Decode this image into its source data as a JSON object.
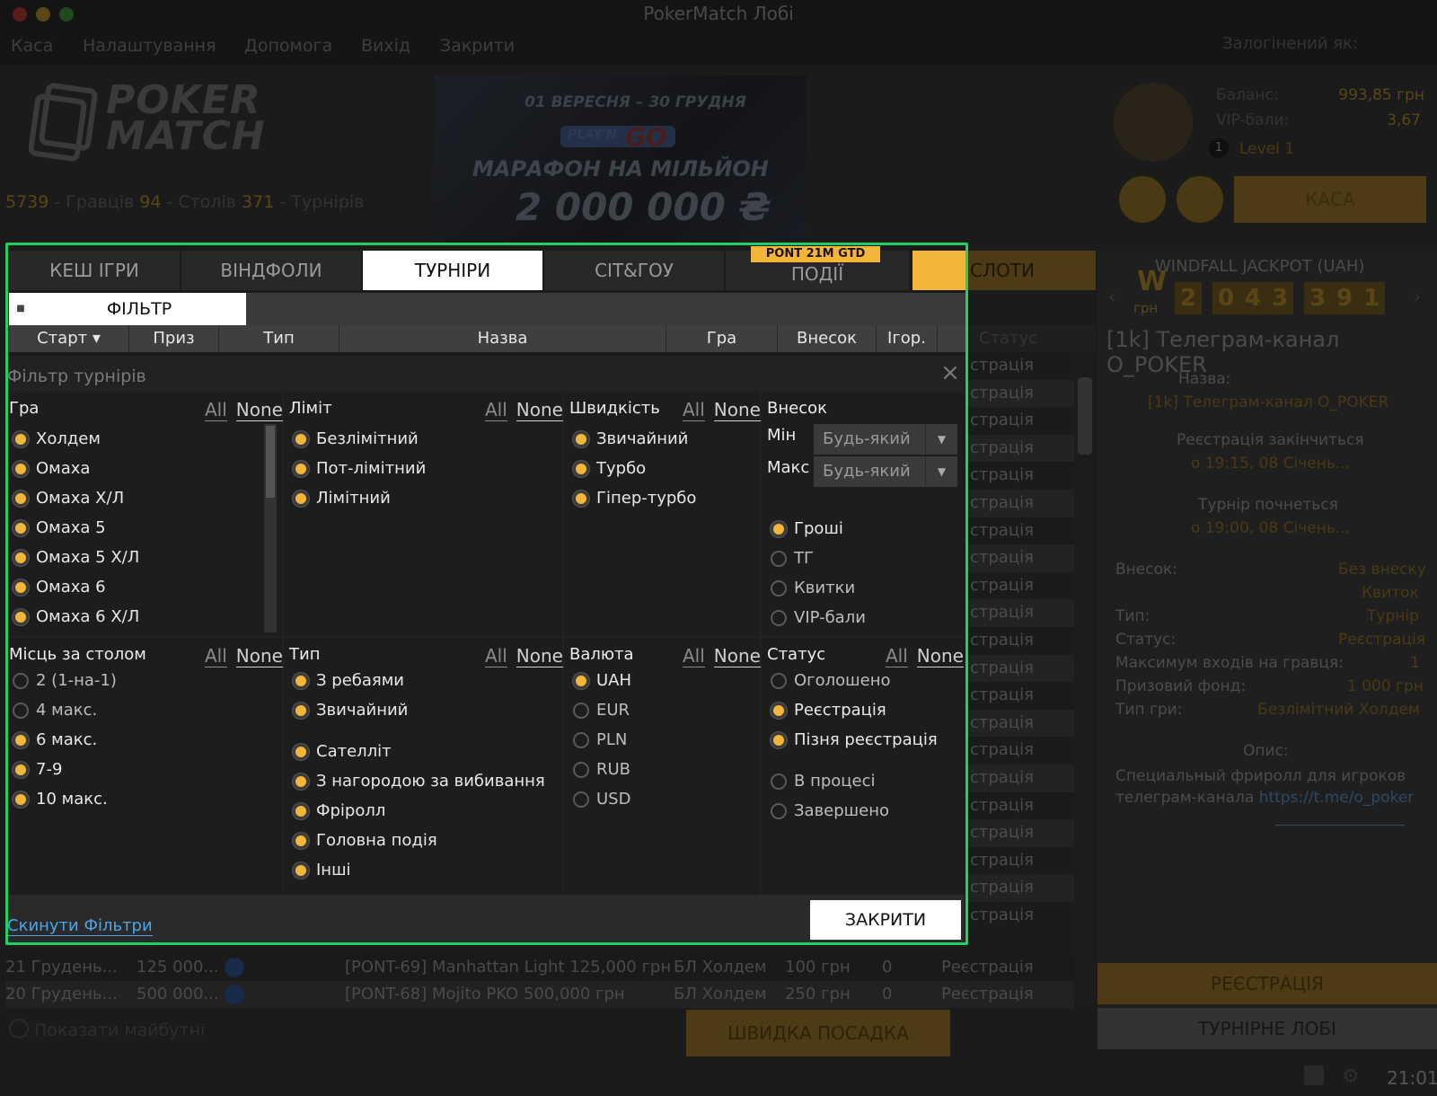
{
  "window": {
    "title": "PokerMatch Лобі"
  },
  "menu": [
    "Каса",
    "Налаштування",
    "Допомога",
    "Вихід",
    "Закрити"
  ],
  "logged_in_label": "Залогінений як:",
  "logo": {
    "line1": "POKER",
    "line2": "MATCH"
  },
  "stats": {
    "players": "5739",
    "players_label": "- Гравців",
    "tables": "94",
    "tables_label": "- Столів",
    "tournaments": "371",
    "tournaments_label": "- Турнірів"
  },
  "banner": {
    "dates": "01 ВЕРЕСНЯ – 30 ГРУДНЯ",
    "brand_a": "PLAY'N",
    "brand_b": "GO",
    "title": "МАРАФОН НА МІЛЬЙОН",
    "amount": "2 000 000 ₴"
  },
  "account": {
    "balance_label": "Баланс:",
    "balance": "993,85 грн",
    "vip_label": "VIP-бали:",
    "vip": "3,67",
    "level_num": "1",
    "level": "Level 1",
    "cashier": "КАСА"
  },
  "tabs": [
    "КЕШ ІГРИ",
    "ВІНДФОЛИ",
    "ТУРНІРИ",
    "СІТ&ГОУ",
    "ПОДІЇ"
  ],
  "promo_badge": "PONT 21M GTD",
  "slots_tab": "СЛОТИ",
  "filter_button": "ФІЛЬТР",
  "columns": [
    "Старт ▾",
    "Приз",
    "Тип",
    "Назва",
    "Гра",
    "Внесок",
    "Ігор."
  ],
  "status_header": "Статус",
  "status_fragment": "страція",
  "list_rows": [
    {
      "start": "21 Грудень...",
      "prize": "125 000...",
      "name": "[PONT-69] Manhattan Light 125,000 грн",
      "game": "БЛ Холдем",
      "buyin": "100 грн",
      "players": "0",
      "status": "Реєстрація"
    },
    {
      "start": "20 Грудень...",
      "prize": "500 000...",
      "name": "[PONT-68] Mojito PKO 500,000 грн",
      "game": "БЛ Холдем",
      "buyin": "250 грн",
      "players": "0",
      "status": "Реєстрація"
    }
  ],
  "show_future": "Показати майбутні",
  "fast_seat": "ШВИДКА ПОСАДКА",
  "jackpot": {
    "title": "WINDFALL JACKPOT (UAH)",
    "currency_w": "W",
    "currency": "грн",
    "digits": [
      "2",
      "0",
      "4",
      "3",
      "3",
      "9",
      "1"
    ]
  },
  "details": {
    "title": "[1k] Телеграм-канал O_POKER",
    "name_label": "Назва:",
    "name": "[1k] Телеграм-канал O_POKER",
    "reg_ends_label": "Реєстрація закінчиться",
    "reg_ends": "о 19:15, 08 Січень...",
    "starts_label": "Турнір почнеться",
    "starts": "о 19:00, 08 Січень...",
    "buyin_label": "Внесок:",
    "buyin": "Без внеску",
    "buyin2": "Квиток",
    "type_label": "Тип:",
    "type": "Турнір",
    "status_label": "Статус:",
    "status": "Реєстрація",
    "max_entries_label": "Максимум входів на гравця:",
    "max_entries": "1",
    "prize_label": "Призовий фонд:",
    "prize": "1 000 грн",
    "game_label": "Тип гри:",
    "game": "Безлімітний Холдем",
    "desc_label": "Опис:",
    "desc": "Специальный фриролл для игроков телеграм-канала",
    "desc_link": "https://t.me/o_poker",
    "register": "РЕЄСТРАЦІЯ",
    "lobby": "ТУРНІРНЕ ЛОБІ"
  },
  "clock": "21:01",
  "filter": {
    "title": "Фільтр турнірів",
    "all": "All",
    "none": "None",
    "game": {
      "title": "Гра",
      "options": [
        {
          "label": "Холдем",
          "on": true
        },
        {
          "label": "Омаха",
          "on": true
        },
        {
          "label": "Омаха Х/Л",
          "on": true
        },
        {
          "label": "Омаха 5",
          "on": true
        },
        {
          "label": "Омаха 5 Х/Л",
          "on": true
        },
        {
          "label": "Омаха 6",
          "on": true
        },
        {
          "label": "Омаха 6 Х/Л",
          "on": true
        }
      ]
    },
    "limit": {
      "title": "Ліміт",
      "options": [
        {
          "label": "Безлімітний",
          "on": true
        },
        {
          "label": "Пот-лімітний",
          "on": true
        },
        {
          "label": "Лімітний",
          "on": true
        }
      ]
    },
    "speed": {
      "title": "Швидкість",
      "options": [
        {
          "label": "Звичайний",
          "on": true
        },
        {
          "label": "Турбо",
          "on": true
        },
        {
          "label": "Гіпер-турбо",
          "on": true
        }
      ]
    },
    "buyin": {
      "title": "Внесок",
      "min_label": "Мін",
      "max_label": "Макс",
      "min_value": "Будь-який",
      "max_value": "Будь-який",
      "options": [
        {
          "label": "Гроші",
          "on": true
        },
        {
          "label": "ТГ",
          "on": false
        },
        {
          "label": "Квитки",
          "on": false
        },
        {
          "label": "VIP-бали",
          "on": false
        }
      ]
    },
    "seats": {
      "title": "Місць за столом",
      "options": [
        {
          "label": "2 (1-на-1)",
          "on": false
        },
        {
          "label": "4 макс.",
          "on": false
        },
        {
          "label": "6 макс.",
          "on": true
        },
        {
          "label": "7-9",
          "on": true
        },
        {
          "label": "10 макс.",
          "on": true
        }
      ]
    },
    "type": {
      "title": "Тип",
      "options": [
        {
          "label": "З ребаями",
          "on": true
        },
        {
          "label": "Звичайний",
          "on": true
        },
        {
          "label": "Сателліт",
          "on": true
        },
        {
          "label": "З нагородою за вибивання",
          "on": true
        },
        {
          "label": "Фріролл",
          "on": true
        },
        {
          "label": "Головна подія",
          "on": true
        },
        {
          "label": "Інші",
          "on": true
        }
      ]
    },
    "currency": {
      "title": "Валюта",
      "options": [
        {
          "label": "UAH",
          "on": true
        },
        {
          "label": "EUR",
          "on": false
        },
        {
          "label": "PLN",
          "on": false
        },
        {
          "label": "RUB",
          "on": false
        },
        {
          "label": "USD",
          "on": false
        }
      ]
    },
    "status": {
      "title": "Статус",
      "options": [
        {
          "label": "Оголошено",
          "on": false
        },
        {
          "label": "Реєстрація",
          "on": true
        },
        {
          "label": "Пізня реєстрація",
          "on": true
        },
        {
          "label": "В процесі",
          "on": false
        },
        {
          "label": "Завершено",
          "on": false
        }
      ]
    },
    "reset": "Скинути Фільтри",
    "close": "ЗАКРИТИ"
  }
}
